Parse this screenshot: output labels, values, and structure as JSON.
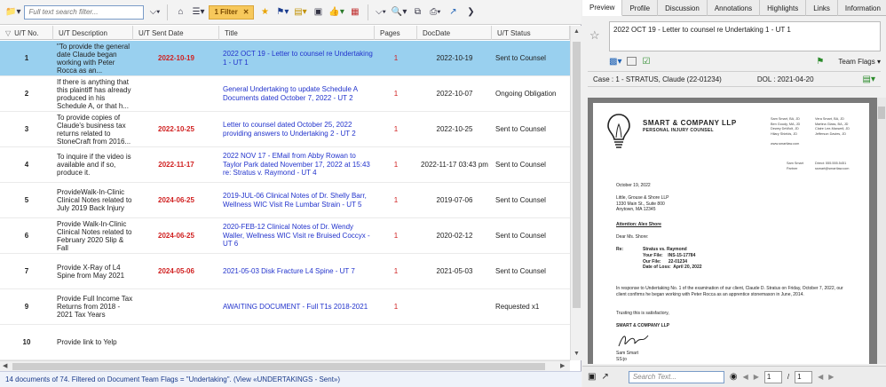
{
  "toolbar": {
    "search_placeholder": "Full text search filter...",
    "filter_badge": "1 Filter",
    "filter_clear": "✕"
  },
  "columns": [
    "U/T No.",
    "U/T Description",
    "U/T Sent Date",
    "Title",
    "Pages",
    "DocDate",
    "U/T Status"
  ],
  "rows": [
    {
      "no": "1",
      "desc": "\"To provide the general date Claude began working with Peter Rocca as an...",
      "sent": "2022-10-19",
      "title": "2022 OCT 19 - Letter to counsel re Undertaking 1 - UT 1",
      "pages": "1",
      "docdate": "2022-10-19",
      "status": "Sent to Counsel",
      "selected": true
    },
    {
      "no": "2",
      "desc": "If there is anything that this plaintiff has already produced in his Schedule A, or that h...",
      "sent": "",
      "title": "General Undertaking to update Schedule A Documents dated October 7, 2022 - UT 2",
      "pages": "1",
      "docdate": "2022-10-07",
      "status": "Ongoing Obligation"
    },
    {
      "no": "3",
      "desc": "To provide copies of Claude's business tax returns related to StoneCraft from 2016...",
      "sent": "2022-10-25",
      "title": "Letter to counsel dated October 25, 2022 providing answers to Undertaking 2 - UT 2",
      "pages": "1",
      "docdate": "2022-10-25",
      "status": "Sent to Counsel"
    },
    {
      "no": "4",
      "desc": "To inquire if the video is available and if so, produce it.",
      "sent": "2022-11-17",
      "title": "2022 NOV 17 - EMail from Abby Rowan to Taylor Park dated  November 17, 2022 at 15:43 re: Stratus v. Raymond - UT 4",
      "pages": "1",
      "docdate": "2022-11-17 03:43 pm",
      "status": "Sent to Counsel"
    },
    {
      "no": "5",
      "desc": "ProvideWalk-In-Clinic Clinical Notes related to July 2019 Back Injury",
      "sent": "2024-06-25",
      "title": "2019-JUL-06 Clinical Notes of Dr. Shelly Barr, Wellness WIC Visit Re Lumbar Strain - UT 5",
      "pages": "1",
      "docdate": "2019-07-06",
      "status": "Sent to Counsel"
    },
    {
      "no": "6",
      "desc": "Provide Walk-In-Clinic Clinical Notes related to February 2020 Slip & Fall",
      "sent": "2024-06-25",
      "title": "2020-FEB-12 Clinical Notes of Dr. Wendy Waller, Wellness WIC Visit re Bruised Coccyx - UT 6",
      "pages": "1",
      "docdate": "2020-02-12",
      "status": "Sent to Counsel"
    },
    {
      "no": "7",
      "desc": "Provide X-Ray of L4 Spine from May 2021",
      "sent": "2024-05-06",
      "title": "2021-05-03 Disk Fracture L4 Spine - UT 7",
      "pages": "1",
      "docdate": "2021-05-03",
      "status": "Sent to Counsel"
    },
    {
      "no": "9",
      "desc": "Provide Full Income Tax Returns from 2018 - 2021 Tax Years",
      "sent": "",
      "title": "AWAITING DOCUMENT - Full T1s 2018-2021",
      "pages": "1",
      "docdate": "",
      "status": "Requested x1"
    },
    {
      "no": "10",
      "desc": "Provide link to Yelp",
      "sent": "",
      "title": "",
      "pages": "",
      "docdate": "",
      "status": ""
    }
  ],
  "status_bar": "14 documents of 74.  Filtered on Document Team Flags = \"Undertaking\".  (View «UNDERTAKINGS - Sent»)",
  "preview": {
    "tabs": [
      "Preview",
      "Profile",
      "Discussion",
      "Annotations",
      "Highlights",
      "Links",
      "Information"
    ],
    "title": "2022 OCT 19 - Letter to counsel re Undertaking 1 - UT 1",
    "team_flags": "Team Flags",
    "case_label": "Case : 1 - STRATUS, Claude (22-01234)",
    "dol_label": "DOL : 2021-04-20",
    "search_placeholder": "Search Text...",
    "page_no": "1",
    "page_total": "1"
  },
  "letter": {
    "firm": "SMART & COMPANY LLP",
    "firm_sub": "PERSONAL INJURY COUNSEL",
    "lawyers_left": "Sam Smart, BA, JD\nBen Goudy, MA, JD\nDewey DeWolt, JD\nHilary Shields, JD",
    "lawyers_right": "Vera Smart, BA, JD\nMartina Glass, BA, JD\nClaire Lee-Maxwell, JD\nJefferson Davies, JD",
    "website": "www.smartlaw.com",
    "contact_name": "Sam Smart\nPartner",
    "contact_info": "Direct: 555.555.5451\nssmart@smartlaw.com",
    "date": "October 19, 2022",
    "addr": "Little, Grouse & Shore LLP\n1330 Main St., Suite 800\nAnytown, MA 12345",
    "attention": "Attention: Alex Shore",
    "salutation": "Dear Ms. Shore:",
    "re_label": "Re:",
    "re_title": "Stratus vs. Raymond",
    "re_rows": "Your File:    INS-15-17784\nOur File:      22-01234\nDate of Loss:  April 20, 2022",
    "body": "In response to Undertaking No. 1 of the examination of our client, Claude D. Stratus on Friday, October 7, 2022, our client confirms he began working with Peter Rocca as an apprentice stonemason in June, 2014.",
    "trust": "Trusting this is satisfactory,",
    "sign_firm": "SMART & COMPANY LLP",
    "sign_name": "Sam Smart\nSS:jo"
  }
}
